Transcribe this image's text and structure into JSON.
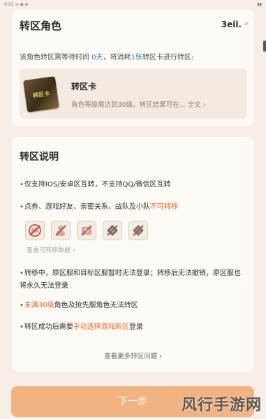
{
  "statusbar": {
    "left": "9:22 ◎ ◉ ◈",
    "right": "▮▮"
  },
  "card1": {
    "title": "转区角色",
    "user": "3eii.",
    "user_icon": "⇄",
    "notice_part1": "该角色转区需等待时间 ",
    "notice_days": "0天",
    "notice_part2": "，将消耗",
    "notice_count": "1张",
    "notice_part3": "转区卡进行转区:",
    "item": {
      "image_text": "转区卡",
      "name": "转区卡",
      "desc": "角色等级需达到30级。转区结果可在... 全文 ›"
    }
  },
  "card2": {
    "title": "转区说明",
    "rule1": "仅支持IOS/安卓区互转，不支持QQ/微信区互转",
    "rule2_main": "点券、游戏好友、亲密关系、战队及小队",
    "rule2_tail": "不可转移",
    "icons": [
      "coupon-icon",
      "friend-icon",
      "relation-icon",
      "team-icon",
      "squad-icon"
    ],
    "see_data": "查看可转移数据 ›",
    "rule3": "转移中，原区服和目标区服暂时无法登录；转移后无法撤销，原区服也将永久无法登录",
    "rule4_highlight": "未满30级",
    "rule4_tail": "角色及抢先服角色无法转区",
    "rule5_main": "转区成功后需要",
    "rule5_highlight": "手动选择游戏新区",
    "rule5_tail": "登录",
    "more_questions": "查看更多转区问题 ›"
  },
  "next_button": "下一步",
  "watermark": "风行手游网",
  "colors": {
    "accent_orange": "#e8672c",
    "accent_blue": "#3c7fc0",
    "button": "#f2b383"
  }
}
